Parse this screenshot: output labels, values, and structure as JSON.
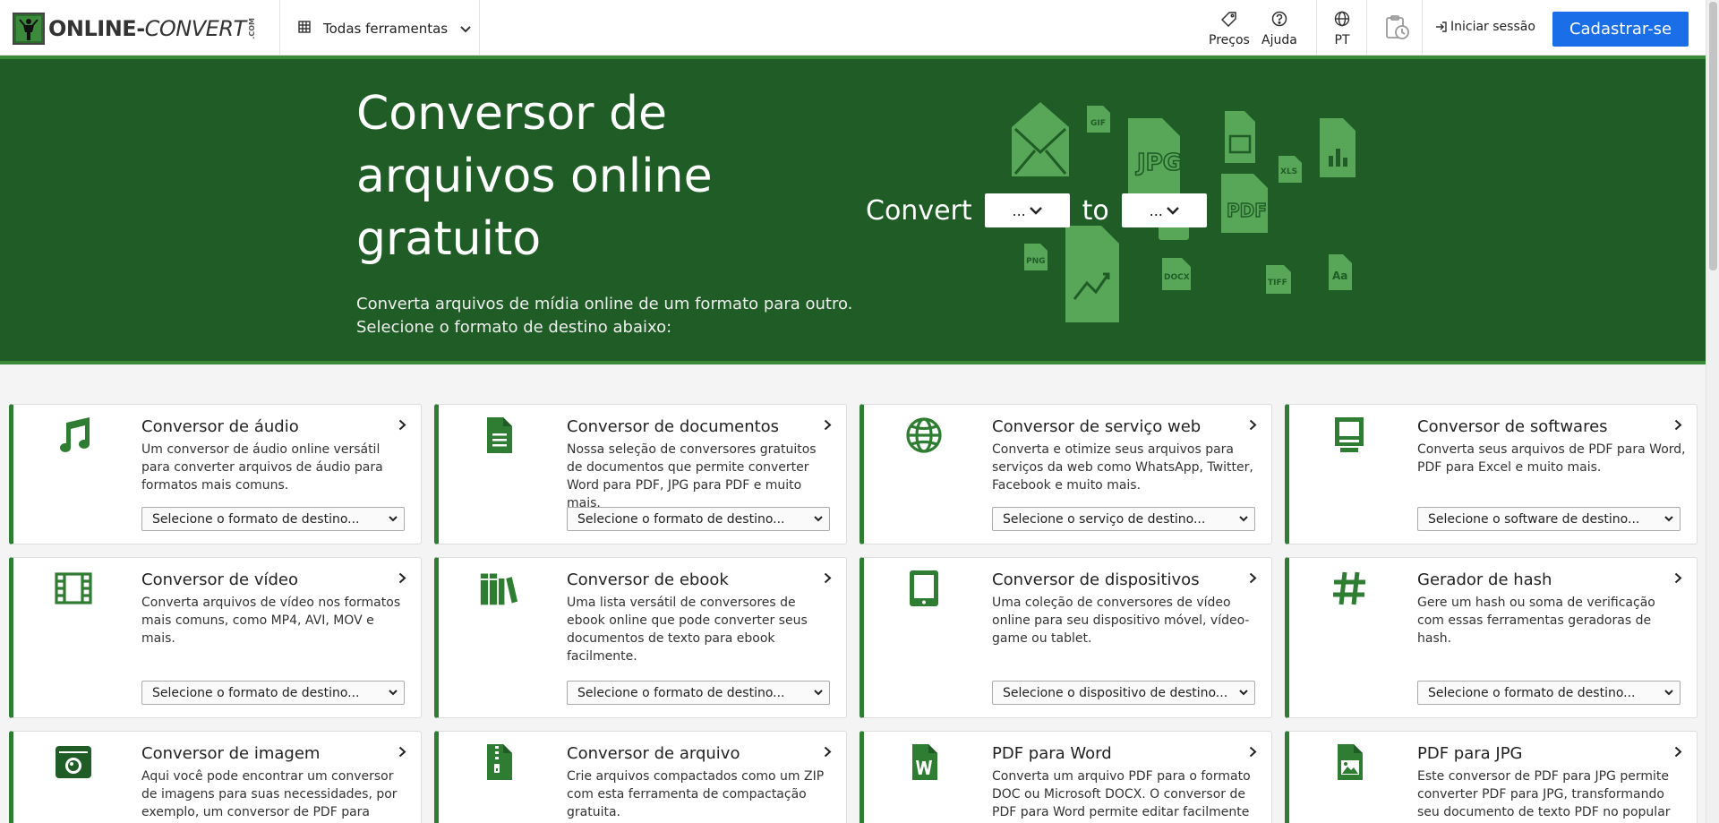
{
  "header": {
    "logo_text_a": "ONLINE-",
    "logo_text_b": "CONVERT",
    "logo_com": ".COM",
    "tools_label": "Todas ferramentas",
    "pricing_label": "Preços",
    "help_label": "Ajuda",
    "lang_label": "PT",
    "login_label": "Iniciar sessão",
    "signup_label": "Cadastrar-se"
  },
  "hero": {
    "title": "Conversor de arquivos online gratuito",
    "subtitle_line1": "Converta arquivos de mídia online de um formato para outro.",
    "subtitle_line2": "Selecione o formato de destino abaixo:",
    "convert_label": "Convert",
    "to_label": "to",
    "from_value": "...",
    "to_value": "...",
    "art_labels": [
      "GIF",
      "JPG",
      "PDF",
      "XLS",
      "PNG",
      "DOCX",
      "TIFF",
      "Aa"
    ]
  },
  "cards": [
    {
      "title": "Conversor de áudio",
      "desc": "Um conversor de áudio online versátil para converter arquivos de áudio para formatos mais comuns.",
      "select": "Selecione o formato de destino...",
      "icon": "music-note-icon"
    },
    {
      "title": "Conversor de documentos",
      "desc": "Nossa seleção de conversores gratuitos de documentos que permite converter Word para PDF, JPG para PDF e muito mais.",
      "select": "Selecione o formato de destino...",
      "icon": "document-icon"
    },
    {
      "title": "Conversor de serviço web",
      "desc": "Converta e otimize seus arquivos para serviços da web como WhatsApp, Twitter, Facebook e muito mais.",
      "select": "Selecione o serviço de destino...",
      "icon": "globe-icon"
    },
    {
      "title": "Conversor de softwares",
      "desc": "Converta seus arquivos de PDF para Word, PDF para Excel e muito mais.",
      "select": "Selecione o software de destino...",
      "icon": "computer-icon"
    },
    {
      "title": "Conversor de vídeo",
      "desc": "Converta arquivos de vídeo nos formatos mais comuns, como MP4, AVI, MOV e mais.",
      "select": "Selecione o formato de destino...",
      "icon": "film-icon"
    },
    {
      "title": "Conversor de ebook",
      "desc": "Uma lista versátil de conversores de ebook online que pode converter seus documentos de texto para ebook facilmente.",
      "select": "Selecione o formato de destino...",
      "icon": "books-icon"
    },
    {
      "title": "Conversor de dispositivos",
      "desc": "Uma coleção de conversores de vídeo online para seu dispositivo móvel, vídeo-game ou tablet.",
      "select": "Selecione o dispositivo de destino...",
      "icon": "tablet-icon"
    },
    {
      "title": "Gerador de hash",
      "desc": "Gere um hash ou soma de verificação com essas ferramentas geradoras de hash.",
      "select": "Selecione o formato de destino...",
      "icon": "hash-icon"
    },
    {
      "title": "Conversor de imagem",
      "desc": "Aqui você pode encontrar um conversor de imagens para suas necessidades, por exemplo, um conversor de PDF para",
      "icon": "camera-icon"
    },
    {
      "title": "Conversor de arquivo",
      "desc": "Crie arquivos compactados como um ZIP com esta ferramenta de compactação gratuita.",
      "icon": "zip-file-icon"
    },
    {
      "title": "PDF para Word",
      "desc": "Converta um arquivo PDF para o formato DOC ou Microsoft DOCX. O conversor de PDF para Word permite editar facilmente",
      "icon": "word-file-icon"
    },
    {
      "title": "PDF para JPG",
      "desc": "Este conversor de PDF para JPG permite converter PDF para JPG, transformando seu documento de texto PDF no popular",
      "icon": "image-file-icon"
    }
  ],
  "colors": {
    "brand_green": "#1f5c26",
    "accent_green": "#2e7d32",
    "signup_blue": "#1a6fe8"
  }
}
